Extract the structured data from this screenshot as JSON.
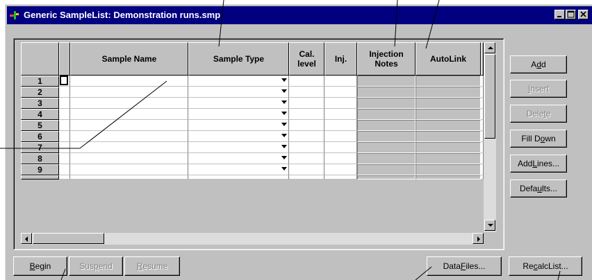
{
  "window": {
    "title": "Generic SampleList: Demonstration runs.smp",
    "icon": "samplelist-app-icon",
    "caption_buttons": [
      "minimize",
      "maximize",
      "close"
    ]
  },
  "grid": {
    "columns": [
      {
        "key": "sample_name",
        "label": "Sample Name"
      },
      {
        "key": "sample_type",
        "label": "Sample Type"
      },
      {
        "key": "cal_level",
        "label": "Cal. level"
      },
      {
        "key": "inj",
        "label": "Inj."
      },
      {
        "key": "injection_notes",
        "label": "Injection Notes"
      },
      {
        "key": "autolink",
        "label": "AutoLink"
      }
    ],
    "row_numbers": [
      "1",
      "2",
      "3",
      "4",
      "5",
      "6",
      "7",
      "8",
      "9"
    ],
    "rows": [
      {
        "sample_name": "",
        "sample_type": "",
        "cal_level": "",
        "inj": "",
        "injection_notes": "",
        "autolink": ""
      },
      {
        "sample_name": "",
        "sample_type": "",
        "cal_level": "",
        "inj": "",
        "injection_notes": "",
        "autolink": ""
      },
      {
        "sample_name": "",
        "sample_type": "",
        "cal_level": "",
        "inj": "",
        "injection_notes": "",
        "autolink": ""
      },
      {
        "sample_name": "",
        "sample_type": "",
        "cal_level": "",
        "inj": "",
        "injection_notes": "",
        "autolink": ""
      },
      {
        "sample_name": "",
        "sample_type": "",
        "cal_level": "",
        "inj": "",
        "injection_notes": "",
        "autolink": ""
      },
      {
        "sample_name": "",
        "sample_type": "",
        "cal_level": "",
        "inj": "",
        "injection_notes": "",
        "autolink": ""
      },
      {
        "sample_name": "",
        "sample_type": "",
        "cal_level": "",
        "inj": "",
        "injection_notes": "",
        "autolink": ""
      },
      {
        "sample_name": "",
        "sample_type": "",
        "cal_level": "",
        "inj": "",
        "injection_notes": "",
        "autolink": ""
      },
      {
        "sample_name": "",
        "sample_type": "",
        "cal_level": "",
        "inj": "",
        "injection_notes": "",
        "autolink": ""
      }
    ]
  },
  "side_buttons": {
    "add": {
      "pre": "A",
      "key": "d",
      "post": "d",
      "enabled": true
    },
    "insert": {
      "pre": "",
      "key": "I",
      "post": "nsert",
      "enabled": false
    },
    "delete": {
      "pre": "Dele",
      "key": "t",
      "post": "e",
      "enabled": false
    },
    "fill_down": {
      "pre": "Fill D",
      "key": "o",
      "post": "wn",
      "enabled": true
    },
    "add_lines": {
      "pre": "Add ",
      "key": "L",
      "post": "ines...",
      "enabled": true
    },
    "defaults": {
      "pre": "Defa",
      "key": "u",
      "post": "lts...",
      "enabled": true
    }
  },
  "bottom_buttons": {
    "begin": {
      "pre": "",
      "key": "B",
      "post": "egin",
      "enabled": true
    },
    "suspend": {
      "pre": "Sus",
      "key": "p",
      "post": "end",
      "enabled": false
    },
    "resume": {
      "pre": "",
      "key": "R",
      "post": "esume",
      "enabled": false
    },
    "data_files": {
      "pre": "Data ",
      "key": "F",
      "post": "iles...",
      "enabled": true
    },
    "recalc_list": {
      "pre": "Re",
      "key": "c",
      "post": "alcList...",
      "enabled": true
    }
  },
  "colors": {
    "titlebar": "#000080",
    "face": "#c0c0c0",
    "disabled_text": "#808080"
  }
}
